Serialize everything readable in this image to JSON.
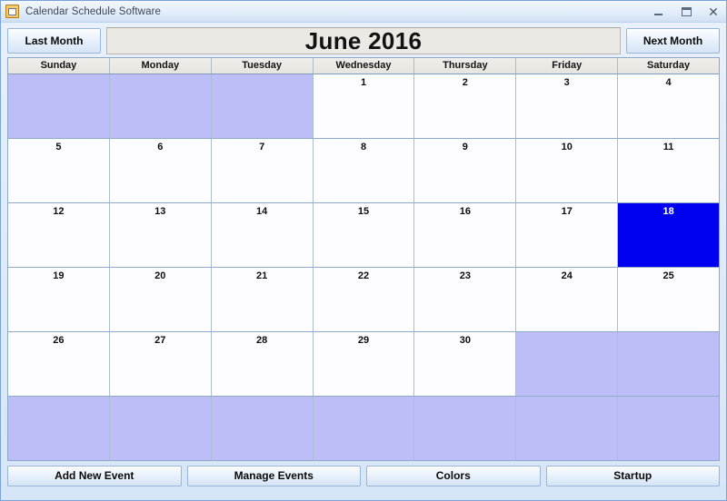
{
  "window": {
    "title": "Calendar Schedule Software",
    "icon": "calendar-app-icon",
    "controls": {
      "minimize": "minimize-icon",
      "maximize": "maximize-icon",
      "close": "✕"
    }
  },
  "toolbar": {
    "last_month_label": "Last Month",
    "next_month_label": "Next Month",
    "month_title": "June 2016"
  },
  "calendar": {
    "day_headers": [
      "Sunday",
      "Monday",
      "Tuesday",
      "Wednesday",
      "Thursday",
      "Friday",
      "Saturday"
    ],
    "selected_day": 18,
    "weeks": [
      [
        {
          "label": "",
          "blank": true
        },
        {
          "label": "",
          "blank": true
        },
        {
          "label": "",
          "blank": true
        },
        {
          "label": "1",
          "blank": false
        },
        {
          "label": "2",
          "blank": false
        },
        {
          "label": "3",
          "blank": false
        },
        {
          "label": "4",
          "blank": false
        }
      ],
      [
        {
          "label": "5",
          "blank": false
        },
        {
          "label": "6",
          "blank": false
        },
        {
          "label": "7",
          "blank": false
        },
        {
          "label": "8",
          "blank": false
        },
        {
          "label": "9",
          "blank": false
        },
        {
          "label": "10",
          "blank": false
        },
        {
          "label": "11",
          "blank": false
        }
      ],
      [
        {
          "label": "12",
          "blank": false
        },
        {
          "label": "13",
          "blank": false
        },
        {
          "label": "14",
          "blank": false
        },
        {
          "label": "15",
          "blank": false
        },
        {
          "label": "16",
          "blank": false
        },
        {
          "label": "17",
          "blank": false
        },
        {
          "label": "18",
          "blank": false,
          "selected": true
        }
      ],
      [
        {
          "label": "19",
          "blank": false
        },
        {
          "label": "20",
          "blank": false
        },
        {
          "label": "21",
          "blank": false
        },
        {
          "label": "22",
          "blank": false
        },
        {
          "label": "23",
          "blank": false
        },
        {
          "label": "24",
          "blank": false
        },
        {
          "label": "25",
          "blank": false
        }
      ],
      [
        {
          "label": "26",
          "blank": false
        },
        {
          "label": "27",
          "blank": false
        },
        {
          "label": "28",
          "blank": false
        },
        {
          "label": "29",
          "blank": false
        },
        {
          "label": "30",
          "blank": false
        },
        {
          "label": "",
          "blank": true
        },
        {
          "label": "",
          "blank": true
        }
      ],
      [
        {
          "label": "",
          "blank": true
        },
        {
          "label": "",
          "blank": true
        },
        {
          "label": "",
          "blank": true
        },
        {
          "label": "",
          "blank": true
        },
        {
          "label": "",
          "blank": true
        },
        {
          "label": "",
          "blank": true
        },
        {
          "label": "",
          "blank": true
        }
      ]
    ]
  },
  "actions": {
    "add_new_event_label": "Add New Event",
    "manage_events_label": "Manage Events",
    "colors_label": "Colors",
    "startup_label": "Startup"
  },
  "colors": {
    "blank_cell": "#bdbdf7",
    "selected_cell": "#0000f0",
    "window_frame": "#cfe0f4",
    "header_panel": "#ebe9e4"
  }
}
